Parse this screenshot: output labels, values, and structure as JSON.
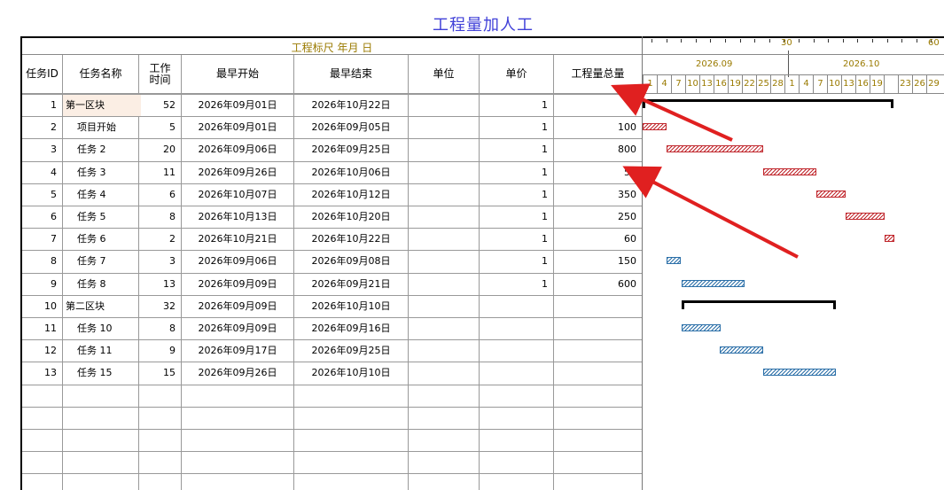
{
  "title": "工程量加人工",
  "scale_label": "工程标尺 年月 日",
  "columns": {
    "id": "任务ID",
    "name": "任务名称",
    "duration": "工作时间",
    "start": "最早开始",
    "finish": "最早结束",
    "unit": "单位",
    "price": "单价",
    "quantity": "工程量总量"
  },
  "timescale": {
    "top_labels": [
      "30",
      "60"
    ],
    "months": [
      "2026.09",
      "2026.10"
    ],
    "days": [
      "1",
      "4",
      "7",
      "10",
      "13",
      "16",
      "19",
      "22",
      "25",
      "28",
      "1",
      "4",
      "7",
      "10",
      "13",
      "16",
      "19",
      "",
      "23",
      "26",
      "29"
    ]
  },
  "rows": [
    {
      "id": "1",
      "name": "第一区块",
      "dur": "52",
      "start": "2026年09月01日",
      "finish": "2026年10月22日",
      "unit": "",
      "price": "1",
      "qty": ""
    },
    {
      "id": "2",
      "name": "项目开始",
      "dur": "5",
      "start": "2026年09月01日",
      "finish": "2026年09月05日",
      "unit": "",
      "price": "1",
      "qty": "100"
    },
    {
      "id": "3",
      "name": "任务 2",
      "dur": "20",
      "start": "2026年09月06日",
      "finish": "2026年09月25日",
      "unit": "",
      "price": "1",
      "qty": "800"
    },
    {
      "id": "4",
      "name": "任务 3",
      "dur": "11",
      "start": "2026年09月26日",
      "finish": "2026年10月06日",
      "unit": "",
      "price": "1",
      "qty": "50"
    },
    {
      "id": "5",
      "name": "任务 4",
      "dur": "6",
      "start": "2026年10月07日",
      "finish": "2026年10月12日",
      "unit": "",
      "price": "1",
      "qty": "350"
    },
    {
      "id": "6",
      "name": "任务 5",
      "dur": "8",
      "start": "2026年10月13日",
      "finish": "2026年10月20日",
      "unit": "",
      "price": "1",
      "qty": "250"
    },
    {
      "id": "7",
      "name": "任务 6",
      "dur": "2",
      "start": "2026年10月21日",
      "finish": "2026年10月22日",
      "unit": "",
      "price": "1",
      "qty": "60"
    },
    {
      "id": "8",
      "name": "任务 7",
      "dur": "3",
      "start": "2026年09月06日",
      "finish": "2026年09月08日",
      "unit": "",
      "price": "1",
      "qty": "150"
    },
    {
      "id": "9",
      "name": "任务 8",
      "dur": "13",
      "start": "2026年09月09日",
      "finish": "2026年09月21日",
      "unit": "",
      "price": "1",
      "qty": "600"
    },
    {
      "id": "10",
      "name": "第二区块",
      "dur": "32",
      "start": "2026年09月09日",
      "finish": "2026年10月10日",
      "unit": "",
      "price": "",
      "qty": ""
    },
    {
      "id": "11",
      "name": "任务 10",
      "dur": "8",
      "start": "2026年09月09日",
      "finish": "2026年09月16日",
      "unit": "",
      "price": "",
      "qty": ""
    },
    {
      "id": "12",
      "name": "任务 11",
      "dur": "9",
      "start": "2026年09月17日",
      "finish": "2026年09月25日",
      "unit": "",
      "price": "",
      "qty": ""
    },
    {
      "id": "13",
      "name": "任务 15",
      "dur": "15",
      "start": "2026年09月26日",
      "finish": "2026年10月10日",
      "unit": "",
      "price": "",
      "qty": ""
    }
  ],
  "bar_colors": {
    "critical": "#c0262c",
    "normal": "#2b6fa8"
  },
  "annotations": [
    "red-arrow",
    "red-arrow",
    "red-arrow"
  ]
}
